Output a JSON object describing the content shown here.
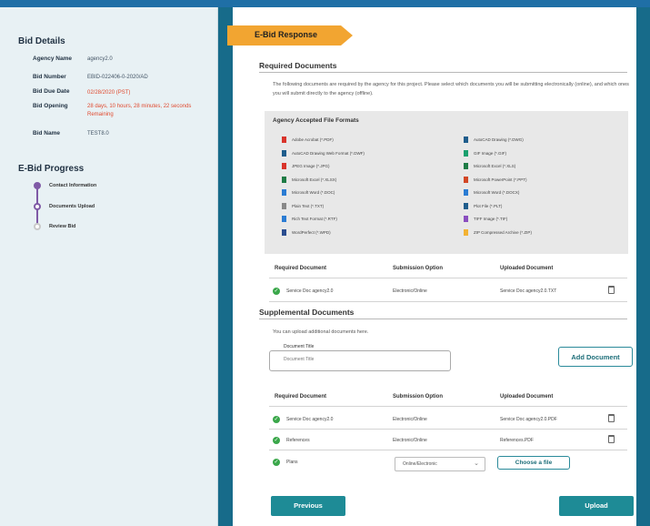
{
  "colors": {
    "accent": "#1e8b96",
    "banner": "#f2a531",
    "frame": "#176b8a",
    "progress": "#7f5aa6",
    "ok": "#3aa74a",
    "deadline": "#e04a2f"
  },
  "sidebar": {
    "bid_details_title": "Bid Details",
    "fields": [
      {
        "label": "Agency Name",
        "value": "agency2.0"
      },
      {
        "label": "Bid Number",
        "value": "EBID-022406-0-2020/AD"
      },
      {
        "label": "Bid Due Date",
        "value": "02/28/2020 (PST)"
      },
      {
        "label": "Bid Opening",
        "value": "28 days, 10 hours, 28 minutes, 22 seconds Remaining"
      },
      {
        "label": "Bid Name",
        "value": "TEST8.0"
      }
    ],
    "progress_title": "E-Bid Progress",
    "steps": [
      {
        "label": "Contact Information",
        "state": "done"
      },
      {
        "label": "Documents Upload",
        "state": "current"
      },
      {
        "label": "Review Bid",
        "state": "todo"
      }
    ]
  },
  "main": {
    "banner": "E-Bid Response",
    "required_title": "Required Documents",
    "required_intro": "The following documents are required by the agency for this project. Please select which documents you will be submitting electronically (online), and which ones you will submit directly to the agency (offline).",
    "formats_title": "Agency Accepted File Formats",
    "formats": [
      {
        "label": "Adobe Acrobat (*.PDF)",
        "icon": "pdf-file-icon",
        "color": "#d9342b"
      },
      {
        "label": "AutoCAD Drawing (*.DWG)",
        "icon": "dwg-file-icon",
        "color": "#1f5d8c"
      },
      {
        "label": "AutoCAD Drawing Web Format (*.DWF)",
        "icon": "dwf-file-icon",
        "color": "#1f5d8c"
      },
      {
        "label": "GIF Image (*.GIF)",
        "icon": "gif-file-icon",
        "color": "#1aa06e"
      },
      {
        "label": "JPEG Image (*.JPG)",
        "icon": "jpg-file-icon",
        "color": "#d9342b"
      },
      {
        "label": "Microsoft Excel (*.XLS)",
        "icon": "xls-file-icon",
        "color": "#1e7b45"
      },
      {
        "label": "Microsoft Excel (*.XLSX)",
        "icon": "xlsx-file-icon",
        "color": "#1e7b45"
      },
      {
        "label": "Microsoft PowerPoint (*.PPT)",
        "icon": "ppt-file-icon",
        "color": "#d24726"
      },
      {
        "label": "Microsoft Word (*.DOC)",
        "icon": "doc-file-icon",
        "color": "#2b7cd3"
      },
      {
        "label": "Microsoft Word (*.DOCX)",
        "icon": "docx-file-icon",
        "color": "#2b7cd3"
      },
      {
        "label": "Plain Text (*.TXT)",
        "icon": "txt-file-icon",
        "color": "#888888"
      },
      {
        "label": "Plot File (*.PLT)",
        "icon": "plt-file-icon",
        "color": "#1f5d8c"
      },
      {
        "label": "Rich Text Format (*.RTF)",
        "icon": "rtf-file-icon",
        "color": "#2b7cd3"
      },
      {
        "label": "TIFF Image (*.TIF)",
        "icon": "tif-file-icon",
        "color": "#8a4fbf"
      },
      {
        "label": "WordPerfect (*.WPD)",
        "icon": "wpd-file-icon",
        "color": "#2a4d8f"
      },
      {
        "label": "ZIP Compressed Archive (*.ZIP)",
        "icon": "zip-file-icon",
        "color": "#f2b233"
      }
    ],
    "columns": {
      "doc": "Required Document",
      "option": "Submission Option",
      "uploaded": "Uploaded Document"
    },
    "required_rows": [
      {
        "doc": "Service Doc agency2.0",
        "option": "Electronic/Online",
        "uploaded": "Service Doc agency2.0.TXT"
      }
    ],
    "supplemental_title": "Supplemental Documents",
    "supplemental_intro": "You can upload additional documents here.",
    "doc_title_legend": "Document Title",
    "doc_title_placeholder": "Document Title",
    "add_document": "Add Document",
    "supplemental_rows": [
      {
        "doc": "Service Doc agency2.0",
        "option": "Electronic/Online",
        "uploaded": "Service Doc agency2.0.PDF"
      },
      {
        "doc": "References",
        "option": "Electronic/Online",
        "uploaded": "References.PDF"
      }
    ],
    "pending_row": {
      "doc": "Plans",
      "option": "Online/Electronic",
      "choose": "Choose a file"
    },
    "previous": "Previous",
    "upload": "Upload"
  }
}
